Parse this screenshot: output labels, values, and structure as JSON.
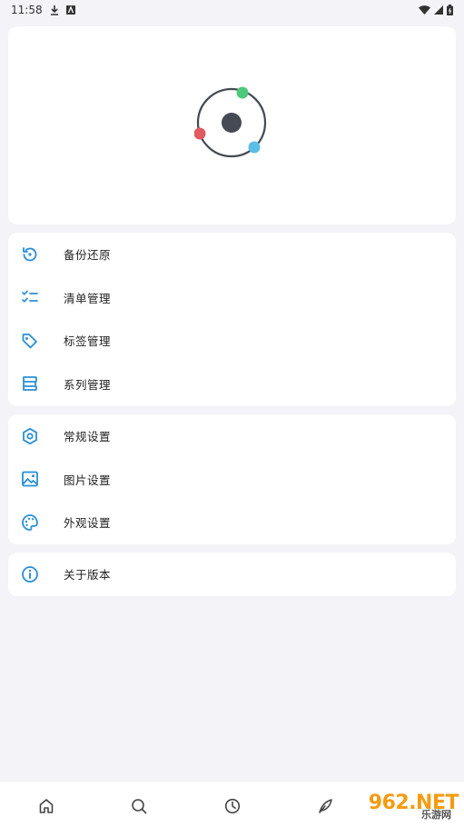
{
  "status_bar": {
    "time": "11:58"
  },
  "sections": {
    "data": [
      {
        "label": "备份还原",
        "icon": "restore-icon"
      },
      {
        "label": "清单管理",
        "icon": "checklist-icon"
      },
      {
        "label": "标签管理",
        "icon": "tag-icon"
      },
      {
        "label": "系列管理",
        "icon": "series-icon"
      }
    ],
    "settings": [
      {
        "label": "常规设置",
        "icon": "hexagon-settings-icon"
      },
      {
        "label": "图片设置",
        "icon": "image-icon"
      },
      {
        "label": "外观设置",
        "icon": "palette-icon"
      }
    ],
    "about": [
      {
        "label": "关于版本",
        "icon": "info-icon"
      }
    ]
  },
  "bottom_nav": [
    {
      "icon": "home-icon"
    },
    {
      "icon": "search-icon"
    },
    {
      "icon": "clock-icon"
    },
    {
      "icon": "feather-icon"
    }
  ],
  "watermark": {
    "brand": "962.NET",
    "sub": "乐游网"
  },
  "colors": {
    "accent": "#2a8fd6",
    "logo_green": "#4cc97a",
    "logo_red": "#e05a5f",
    "logo_blue": "#5bbde8",
    "logo_dark": "#454a54"
  }
}
